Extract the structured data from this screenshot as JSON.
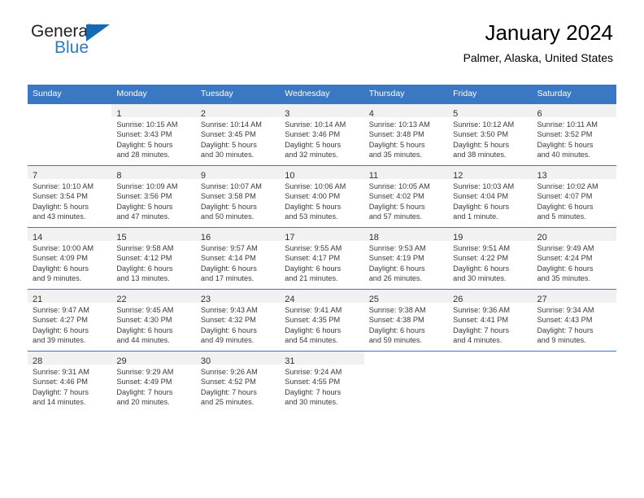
{
  "logo": {
    "word1": "General",
    "word2": "Blue",
    "triangle_color": "#166ab3",
    "blue_text_color": "#2b7cc3",
    "icon": "blue-triangle-logo-icon"
  },
  "header": {
    "title": "January 2024",
    "subtitle": "Palmer, Alaska, United States",
    "accent_color": "#3b78c3"
  },
  "weekday_headers": [
    "Sunday",
    "Monday",
    "Tuesday",
    "Wednesday",
    "Thursday",
    "Friday",
    "Saturday"
  ],
  "labels": {
    "sunrise": "Sunrise:",
    "sunset": "Sunset:",
    "daylight": "Daylight:"
  },
  "weeks": [
    [
      {
        "day": "",
        "lines": []
      },
      {
        "day": "1",
        "lines": [
          "Sunrise: 10:15 AM",
          "Sunset: 3:43 PM",
          "Daylight: 5 hours",
          "and 28 minutes."
        ]
      },
      {
        "day": "2",
        "lines": [
          "Sunrise: 10:14 AM",
          "Sunset: 3:45 PM",
          "Daylight: 5 hours",
          "and 30 minutes."
        ]
      },
      {
        "day": "3",
        "lines": [
          "Sunrise: 10:14 AM",
          "Sunset: 3:46 PM",
          "Daylight: 5 hours",
          "and 32 minutes."
        ]
      },
      {
        "day": "4",
        "lines": [
          "Sunrise: 10:13 AM",
          "Sunset: 3:48 PM",
          "Daylight: 5 hours",
          "and 35 minutes."
        ]
      },
      {
        "day": "5",
        "lines": [
          "Sunrise: 10:12 AM",
          "Sunset: 3:50 PM",
          "Daylight: 5 hours",
          "and 38 minutes."
        ]
      },
      {
        "day": "6",
        "lines": [
          "Sunrise: 10:11 AM",
          "Sunset: 3:52 PM",
          "Daylight: 5 hours",
          "and 40 minutes."
        ]
      }
    ],
    [
      {
        "day": "7",
        "lines": [
          "Sunrise: 10:10 AM",
          "Sunset: 3:54 PM",
          "Daylight: 5 hours",
          "and 43 minutes."
        ]
      },
      {
        "day": "8",
        "lines": [
          "Sunrise: 10:09 AM",
          "Sunset: 3:56 PM",
          "Daylight: 5 hours",
          "and 47 minutes."
        ]
      },
      {
        "day": "9",
        "lines": [
          "Sunrise: 10:07 AM",
          "Sunset: 3:58 PM",
          "Daylight: 5 hours",
          "and 50 minutes."
        ]
      },
      {
        "day": "10",
        "lines": [
          "Sunrise: 10:06 AM",
          "Sunset: 4:00 PM",
          "Daylight: 5 hours",
          "and 53 minutes."
        ]
      },
      {
        "day": "11",
        "lines": [
          "Sunrise: 10:05 AM",
          "Sunset: 4:02 PM",
          "Daylight: 5 hours",
          "and 57 minutes."
        ]
      },
      {
        "day": "12",
        "lines": [
          "Sunrise: 10:03 AM",
          "Sunset: 4:04 PM",
          "Daylight: 6 hours",
          "and 1 minute."
        ]
      },
      {
        "day": "13",
        "lines": [
          "Sunrise: 10:02 AM",
          "Sunset: 4:07 PM",
          "Daylight: 6 hours",
          "and 5 minutes."
        ]
      }
    ],
    [
      {
        "day": "14",
        "lines": [
          "Sunrise: 10:00 AM",
          "Sunset: 4:09 PM",
          "Daylight: 6 hours",
          "and 9 minutes."
        ]
      },
      {
        "day": "15",
        "lines": [
          "Sunrise: 9:58 AM",
          "Sunset: 4:12 PM",
          "Daylight: 6 hours",
          "and 13 minutes."
        ]
      },
      {
        "day": "16",
        "lines": [
          "Sunrise: 9:57 AM",
          "Sunset: 4:14 PM",
          "Daylight: 6 hours",
          "and 17 minutes."
        ]
      },
      {
        "day": "17",
        "lines": [
          "Sunrise: 9:55 AM",
          "Sunset: 4:17 PM",
          "Daylight: 6 hours",
          "and 21 minutes."
        ]
      },
      {
        "day": "18",
        "lines": [
          "Sunrise: 9:53 AM",
          "Sunset: 4:19 PM",
          "Daylight: 6 hours",
          "and 26 minutes."
        ]
      },
      {
        "day": "19",
        "lines": [
          "Sunrise: 9:51 AM",
          "Sunset: 4:22 PM",
          "Daylight: 6 hours",
          "and 30 minutes."
        ]
      },
      {
        "day": "20",
        "lines": [
          "Sunrise: 9:49 AM",
          "Sunset: 4:24 PM",
          "Daylight: 6 hours",
          "and 35 minutes."
        ]
      }
    ],
    [
      {
        "day": "21",
        "lines": [
          "Sunrise: 9:47 AM",
          "Sunset: 4:27 PM",
          "Daylight: 6 hours",
          "and 39 minutes."
        ]
      },
      {
        "day": "22",
        "lines": [
          "Sunrise: 9:45 AM",
          "Sunset: 4:30 PM",
          "Daylight: 6 hours",
          "and 44 minutes."
        ]
      },
      {
        "day": "23",
        "lines": [
          "Sunrise: 9:43 AM",
          "Sunset: 4:32 PM",
          "Daylight: 6 hours",
          "and 49 minutes."
        ]
      },
      {
        "day": "24",
        "lines": [
          "Sunrise: 9:41 AM",
          "Sunset: 4:35 PM",
          "Daylight: 6 hours",
          "and 54 minutes."
        ]
      },
      {
        "day": "25",
        "lines": [
          "Sunrise: 9:38 AM",
          "Sunset: 4:38 PM",
          "Daylight: 6 hours",
          "and 59 minutes."
        ]
      },
      {
        "day": "26",
        "lines": [
          "Sunrise: 9:36 AM",
          "Sunset: 4:41 PM",
          "Daylight: 7 hours",
          "and 4 minutes."
        ]
      },
      {
        "day": "27",
        "lines": [
          "Sunrise: 9:34 AM",
          "Sunset: 4:43 PM",
          "Daylight: 7 hours",
          "and 9 minutes."
        ]
      }
    ],
    [
      {
        "day": "28",
        "lines": [
          "Sunrise: 9:31 AM",
          "Sunset: 4:46 PM",
          "Daylight: 7 hours",
          "and 14 minutes."
        ]
      },
      {
        "day": "29",
        "lines": [
          "Sunrise: 9:29 AM",
          "Sunset: 4:49 PM",
          "Daylight: 7 hours",
          "and 20 minutes."
        ]
      },
      {
        "day": "30",
        "lines": [
          "Sunrise: 9:26 AM",
          "Sunset: 4:52 PM",
          "Daylight: 7 hours",
          "and 25 minutes."
        ]
      },
      {
        "day": "31",
        "lines": [
          "Sunrise: 9:24 AM",
          "Sunset: 4:55 PM",
          "Daylight: 7 hours",
          "and 30 minutes."
        ]
      },
      {
        "day": "",
        "lines": []
      },
      {
        "day": "",
        "lines": []
      },
      {
        "day": "",
        "lines": []
      }
    ]
  ]
}
